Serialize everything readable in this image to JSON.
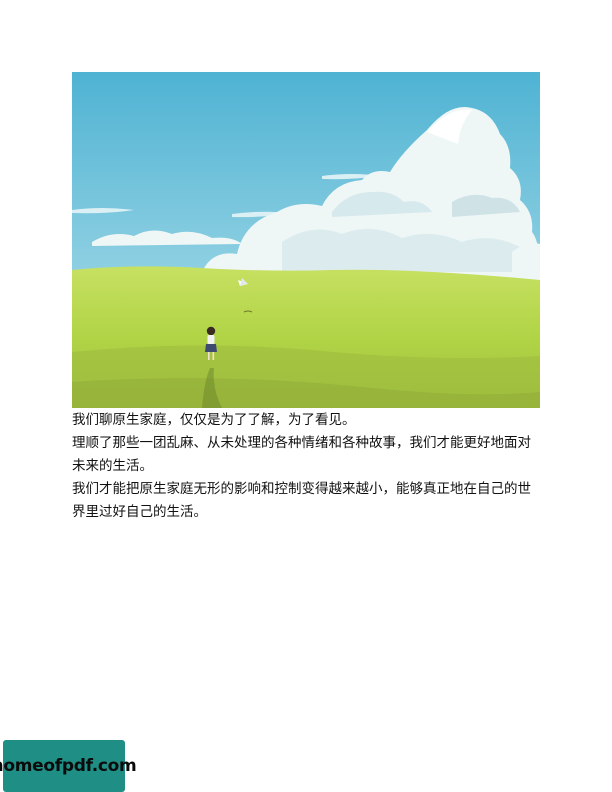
{
  "document": {
    "paragraphs": [
      "我们聊原生家庭，仅仅是为了了解，为了看见。",
      "理顺了那些一团乱麻、从未处理的各种情绪和各种故事，我们才能更好地面对未来的生活。",
      "我们才能把原生家庭无形的影响和控制变得越来越小，能够真正地在自己的世界里过好自己的生活。"
    ]
  },
  "watermark": {
    "label": "homeofpdf.com"
  },
  "colors": {
    "sky_top": "#5bbad6",
    "sky_bottom": "#a9dde8",
    "grass": "#b6d94a",
    "grass_dark": "#8fae3a",
    "cloud": "#eef6f6",
    "badge_bg": "#1f8f86"
  }
}
